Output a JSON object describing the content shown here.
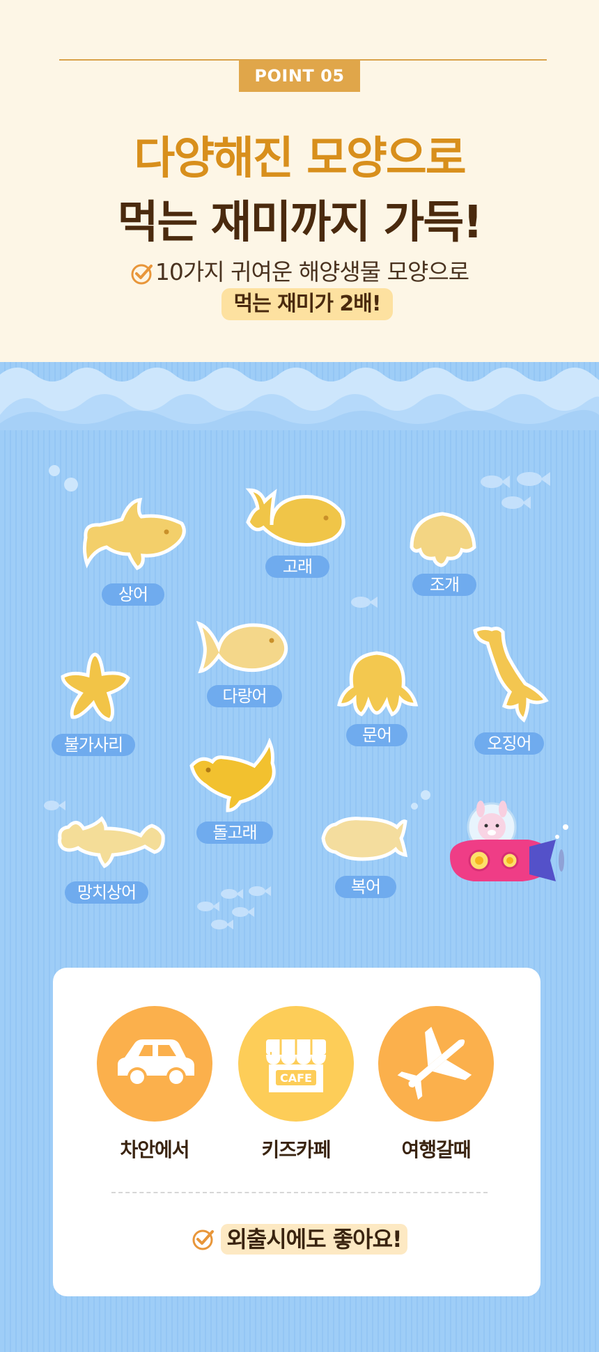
{
  "point_badge": "POINT 05",
  "headline": {
    "line1": "다양해진 모양으로",
    "line2": "먹는 재미까지 가득!"
  },
  "subtitle": {
    "line1": "10가지 귀여운 해양생물 모양으로",
    "line2": "먹는 재미가 2배!"
  },
  "snacks": [
    {
      "label": "상어",
      "shape": "shark"
    },
    {
      "label": "고래",
      "shape": "whale"
    },
    {
      "label": "조개",
      "shape": "clam"
    },
    {
      "label": "불가사리",
      "shape": "starfish"
    },
    {
      "label": "다랑어",
      "shape": "tuna"
    },
    {
      "label": "문어",
      "shape": "octopus"
    },
    {
      "label": "오징어",
      "shape": "squid"
    },
    {
      "label": "돌고래",
      "shape": "dolphin"
    },
    {
      "label": "망치상어",
      "shape": "hammerhead"
    },
    {
      "label": "복어",
      "shape": "pufferfish"
    }
  ],
  "uses": [
    {
      "label": "차안에서",
      "icon": "car-icon"
    },
    {
      "label": "키즈카페",
      "icon": "cafe-icon",
      "icon_text": "CAFE"
    },
    {
      "label": "여행갈때",
      "icon": "airplane-icon"
    }
  ],
  "footer": "외출시에도 좋아요!",
  "colors": {
    "cream_bg": "#fdf6e6",
    "badge": "#e0a64a",
    "headline_orange": "#d88f1c",
    "headline_brown": "#4a2a0e",
    "highlight": "#fde1a0",
    "ocean": "#9ecdf7",
    "label_blue": "#6fabee",
    "circle_orange": "#fbb04c",
    "circle_yellow": "#fdcd58"
  }
}
